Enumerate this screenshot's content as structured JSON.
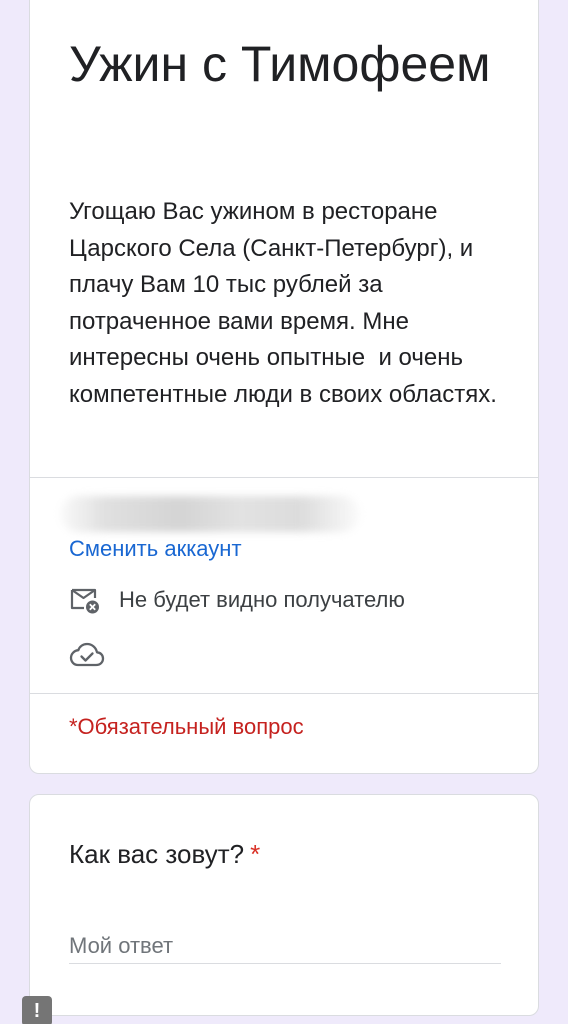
{
  "form": {
    "title": "Ужин с Тимофеем",
    "description": "Угощаю Вас ужином в ресторане Царского Села (Санкт-Петербург), и плачу Вам 10 тыс рублей за потраченное вами время. Мне интересны очень опытные  и очень компетентные люди в своих областях.",
    "accent_color": "#673ab7"
  },
  "account": {
    "switch_label": "Сменить аккаунт",
    "visibility_notice": "Не будет видно получателю",
    "notice_icon": "mail-hidden-icon",
    "saved_icon": "cloud-check-icon"
  },
  "required_note": "*Обязательный вопрос",
  "question": {
    "title": "Как вас зовут?",
    "required_mark": "*",
    "placeholder": "Мой ответ",
    "value": ""
  },
  "alert_badge": "!"
}
